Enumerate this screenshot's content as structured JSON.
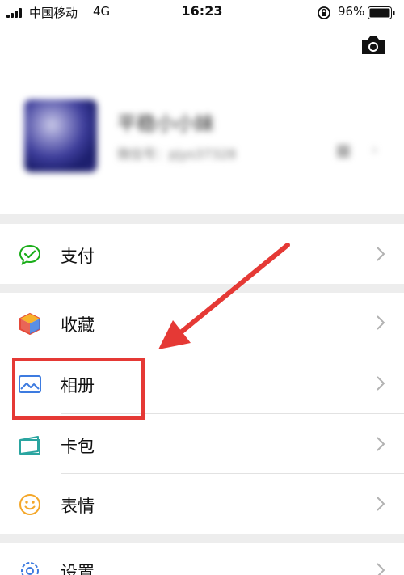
{
  "status_bar": {
    "carrier": "中国移动",
    "network": "4G",
    "time": "16:23",
    "battery_percent": "96%",
    "icons": [
      "signal-icon",
      "orientation-lock-icon",
      "battery-icon"
    ]
  },
  "header": {
    "camera_icon": "camera-icon",
    "profile": {
      "nickname": "平稳小小妹",
      "wechat_id": "微信号：pjys37328",
      "note": "blurred"
    }
  },
  "menu": {
    "pay": {
      "label": "支付",
      "icon": "pay-icon",
      "color": "#1aad19"
    },
    "favorites": {
      "label": "收藏",
      "icon": "favorites-cube-icon"
    },
    "album": {
      "label": "相册",
      "icon": "album-icon",
      "color": "#3d7be0"
    },
    "cards": {
      "label": "卡包",
      "icon": "card-wallet-icon",
      "color": "#2aa5a0"
    },
    "stickers": {
      "label": "表情",
      "icon": "smiley-icon",
      "color": "#f4a72a"
    },
    "settings": {
      "label": "设置",
      "icon": "settings-gear-icon",
      "color": "#3d7be0"
    }
  },
  "annotation": {
    "highlight_color": "#e53935",
    "highlighted_item": "album"
  }
}
